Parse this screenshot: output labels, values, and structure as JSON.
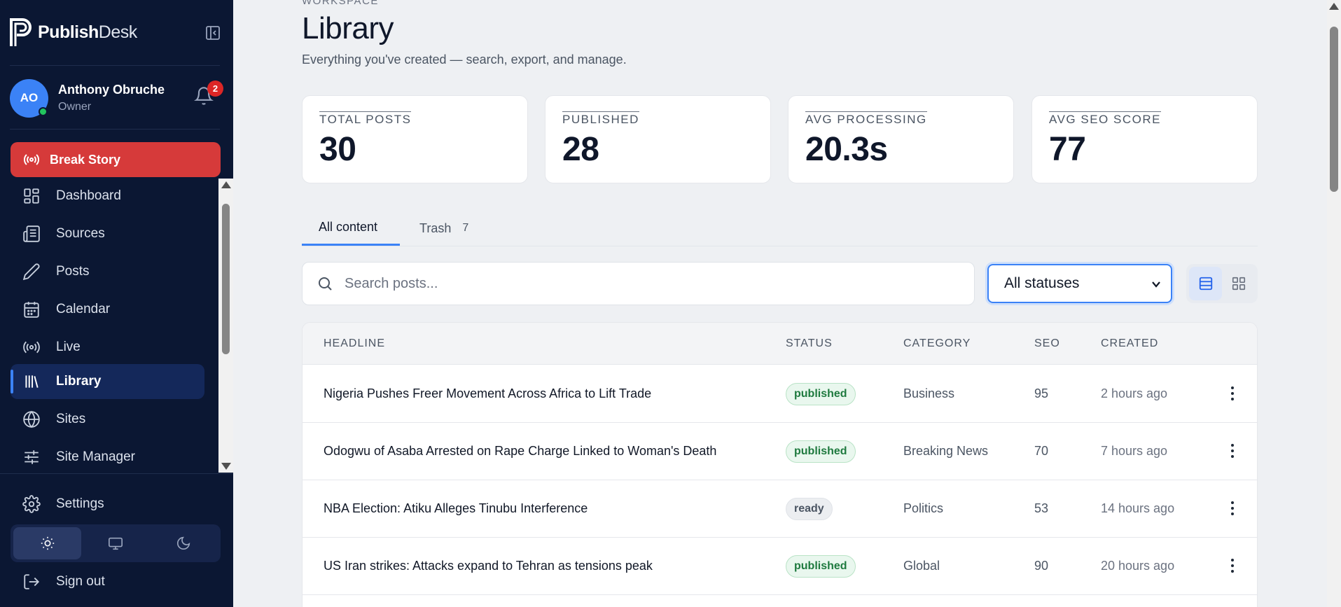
{
  "app": {
    "brand_bold": "Publish",
    "brand_light": "Desk"
  },
  "user": {
    "initials": "AO",
    "name": "Anthony Obruche",
    "role": "Owner",
    "notifications": "2"
  },
  "sidebar": {
    "break_story": "Break Story",
    "items": [
      {
        "label": "Dashboard",
        "icon": "dashboard-icon"
      },
      {
        "label": "Sources",
        "icon": "newspaper-icon"
      },
      {
        "label": "Posts",
        "icon": "pen-icon"
      },
      {
        "label": "Calendar",
        "icon": "calendar-icon"
      },
      {
        "label": "Live",
        "icon": "broadcast-icon"
      },
      {
        "label": "Library",
        "icon": "library-icon"
      },
      {
        "label": "Sites",
        "icon": "globe-icon"
      },
      {
        "label": "Site Manager",
        "icon": "sliders-icon"
      }
    ],
    "settings": "Settings",
    "sign_out": "Sign out"
  },
  "header": {
    "eyebrow": "WORKSPACE",
    "title": "Library",
    "subtitle": "Everything you've created — search, export, and manage."
  },
  "stats": [
    {
      "label": "TOTAL POSTS",
      "value": "30"
    },
    {
      "label": "PUBLISHED",
      "value": "28"
    },
    {
      "label": "AVG PROCESSING",
      "value": "20.3s"
    },
    {
      "label": "AVG SEO SCORE",
      "value": "77"
    }
  ],
  "tabs": [
    {
      "label": "All content",
      "count": ""
    },
    {
      "label": "Trash",
      "count": "7"
    }
  ],
  "filters": {
    "search_placeholder": "Search posts...",
    "status_selected": "All statuses"
  },
  "table": {
    "columns": [
      "HEADLINE",
      "STATUS",
      "CATEGORY",
      "SEO",
      "CREATED"
    ],
    "rows": [
      {
        "headline": "Nigeria Pushes Freer Movement Across Africa to Lift Trade",
        "status": "published",
        "category": "Business",
        "seo": "95",
        "created": "2 hours ago"
      },
      {
        "headline": "Odogwu of Asaba Arrested on Rape Charge Linked to Woman's Death",
        "status": "published",
        "category": "Breaking News",
        "seo": "70",
        "created": "7 hours ago"
      },
      {
        "headline": "NBA Election: Atiku Alleges Tinubu Interference",
        "status": "ready",
        "category": "Politics",
        "seo": "53",
        "created": "14 hours ago"
      },
      {
        "headline": "US Iran strikes: Attacks expand to Tehran as tensions peak",
        "status": "published",
        "category": "Global",
        "seo": "90",
        "created": "20 hours ago"
      }
    ]
  },
  "colors": {
    "sidebar_bg": "#0b1733",
    "accent": "#3b82f6",
    "break_red": "#d63a3a",
    "page_bg": "#eef0f3"
  }
}
